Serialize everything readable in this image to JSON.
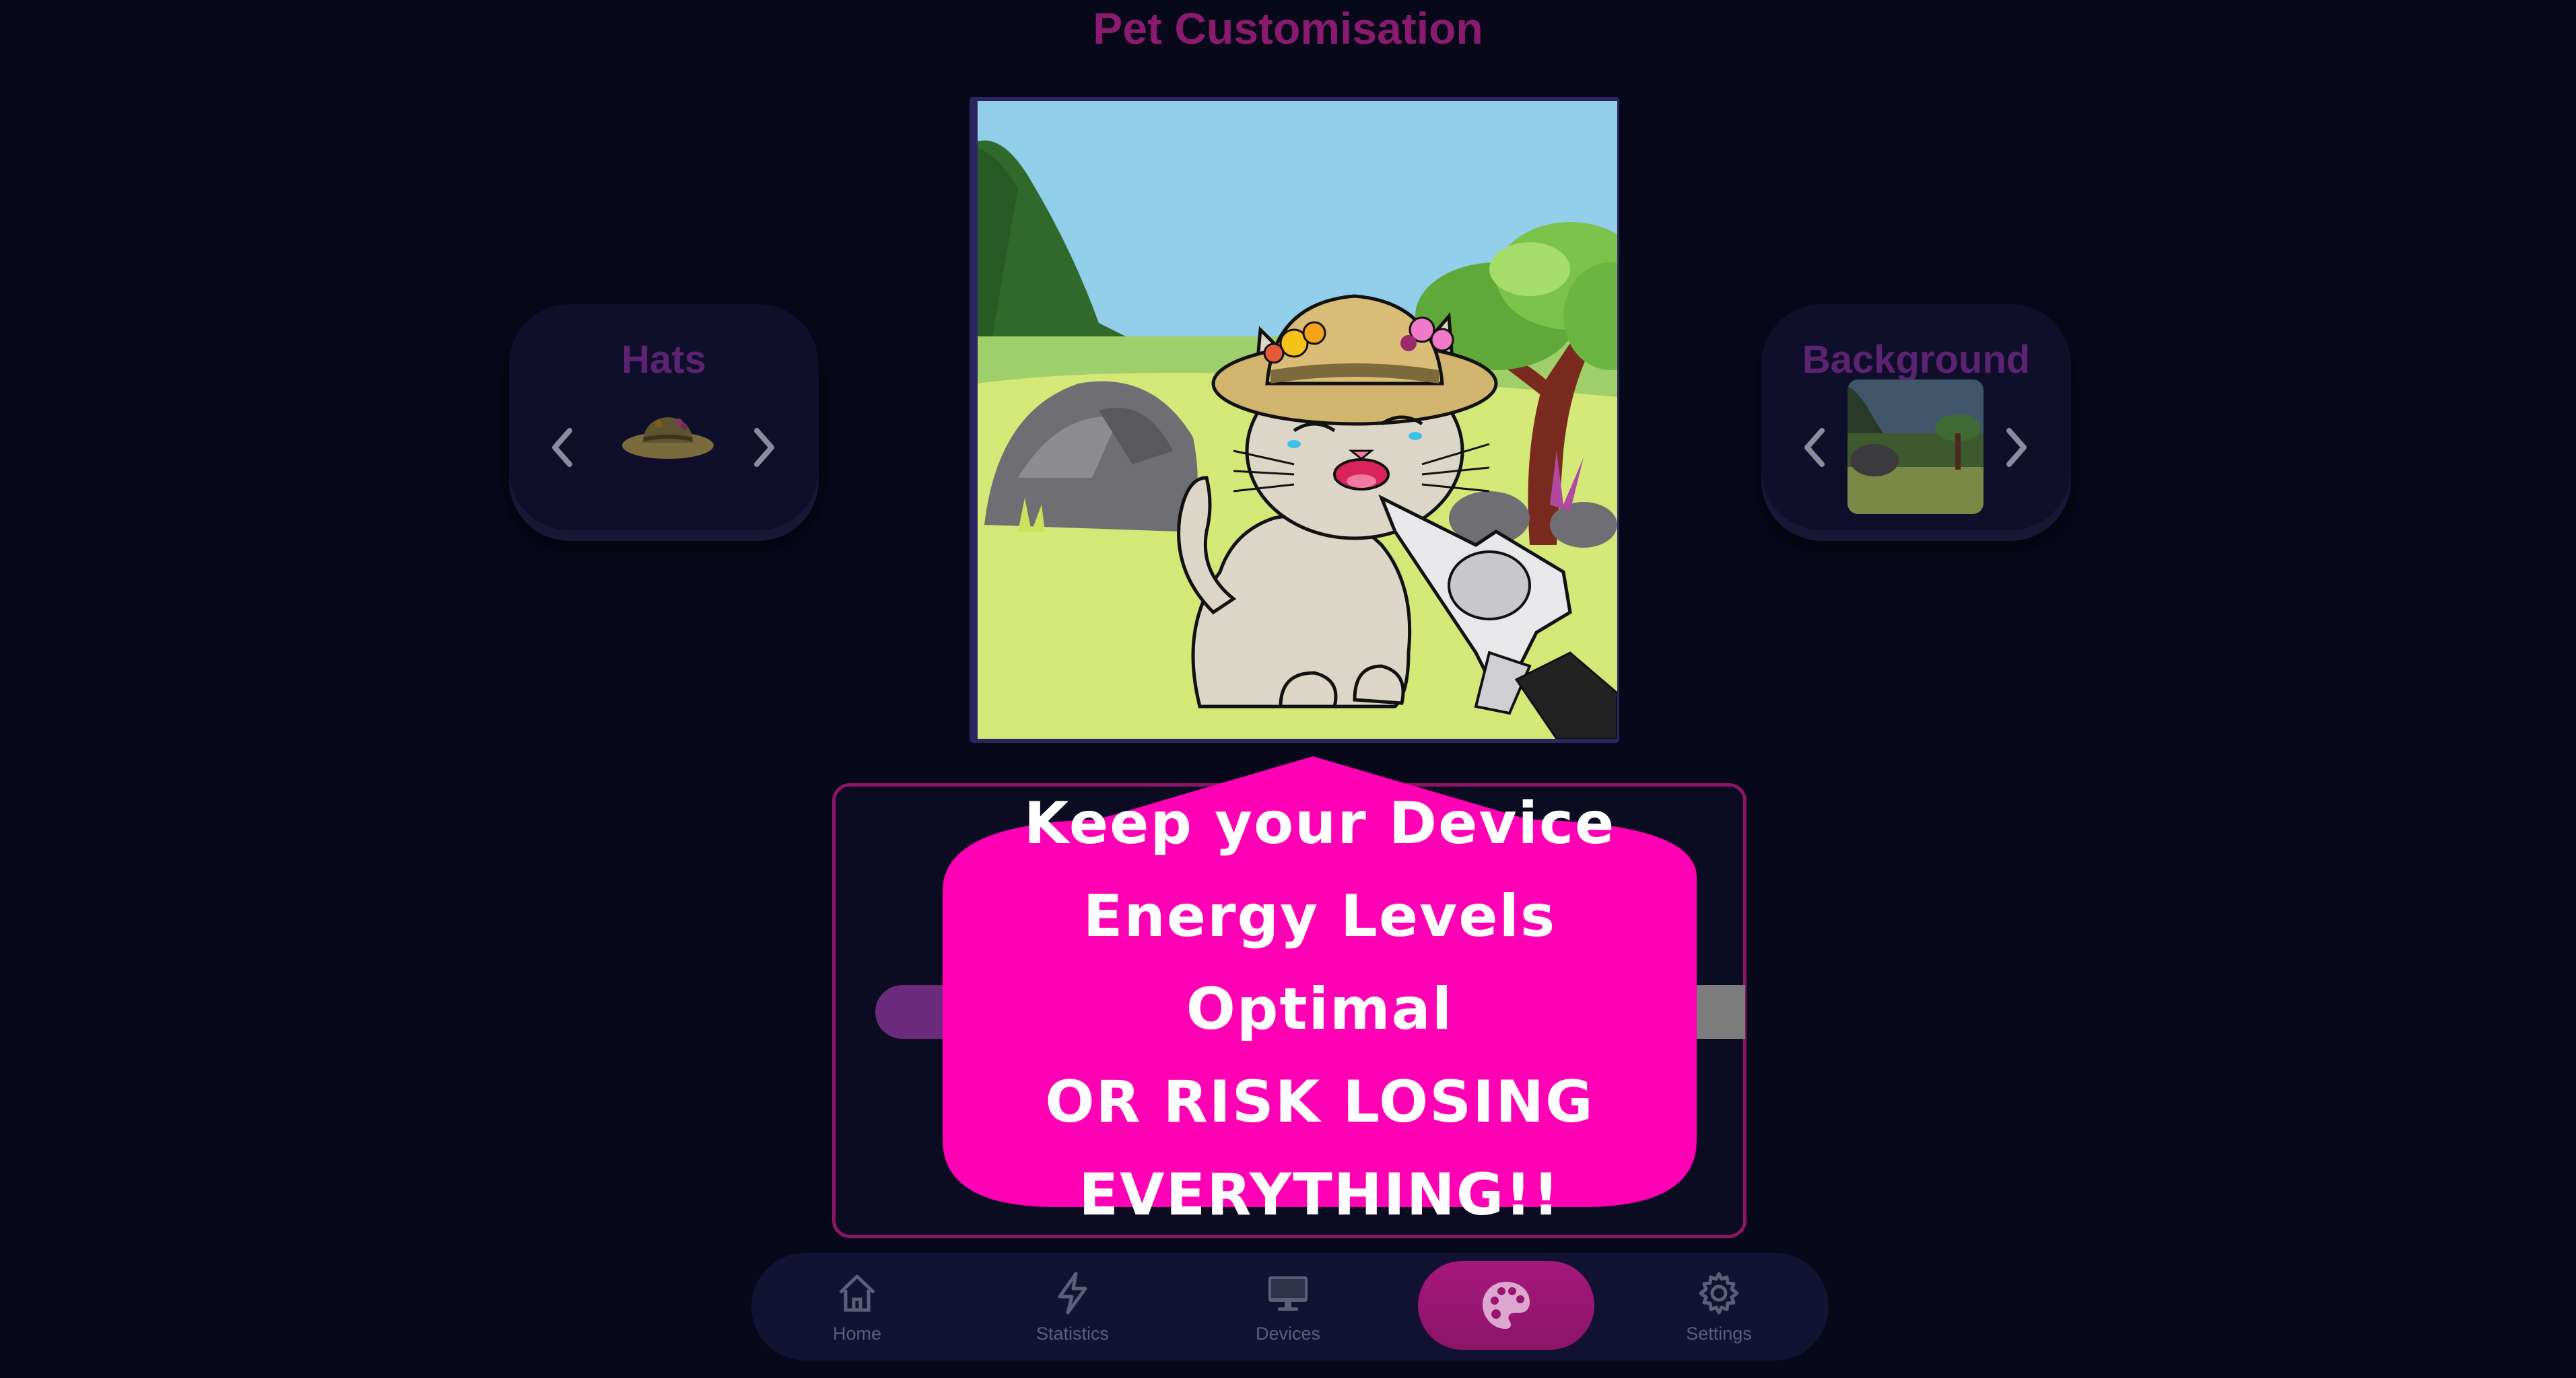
{
  "page": {
    "title": "Pet Customisation"
  },
  "hats": {
    "label": "Hats",
    "selected_icon": "sun-hat-icon"
  },
  "background": {
    "label": "Background",
    "selected_icon": "meadow-background-thumbnail"
  },
  "preview": {
    "subject": "cat-wearing-hat-illustration"
  },
  "message": {
    "lines": [
      "Keep your Device",
      "Energy Levels Optimal",
      "OR RISK LOSING",
      "EVERYTHING!!"
    ],
    "bubble_color": "#ff00b4"
  },
  "energy_bar": {
    "fill_fraction": 0.74,
    "fill_color": "#6b2a7c",
    "track_color": "#7c7c7c"
  },
  "nav": {
    "items": [
      {
        "label": "Home",
        "icon": "home-icon"
      },
      {
        "label": "Statistics",
        "icon": "lightning-icon"
      },
      {
        "label": "Devices",
        "icon": "monitor-icon"
      },
      {
        "label": "",
        "icon": "palette-icon",
        "active": true
      },
      {
        "label": "Settings",
        "icon": "gear-icon"
      }
    ]
  },
  "colors": {
    "background": "#07081a",
    "accent": "#a5187c",
    "title": "#8a1a6e",
    "card": "#0f0f2b"
  }
}
